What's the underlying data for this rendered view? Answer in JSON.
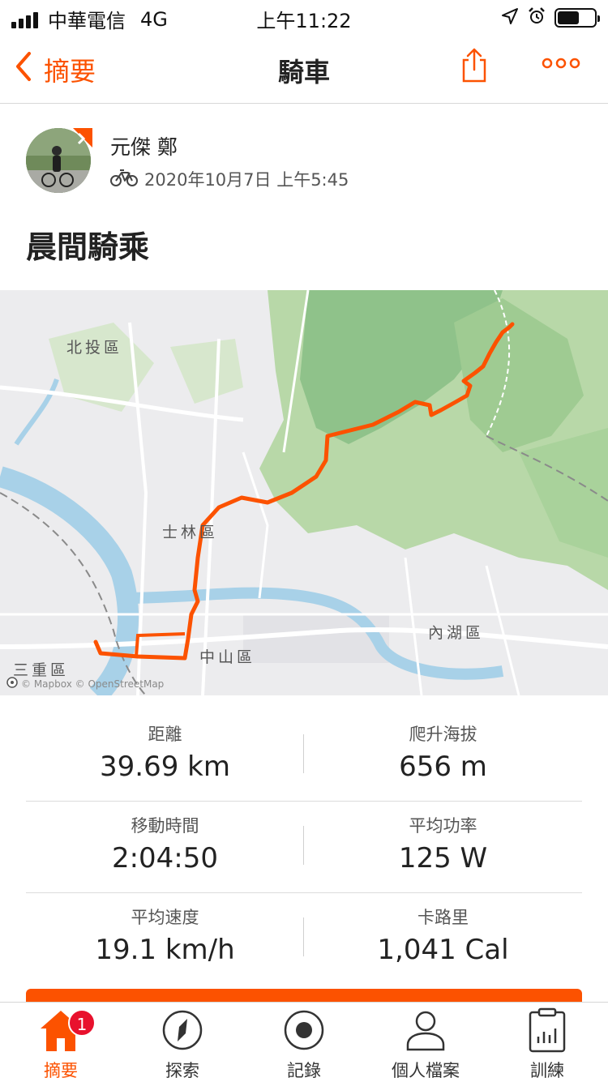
{
  "status_bar": {
    "carrier": "中華電信",
    "network": "4G",
    "time": "上午11:22",
    "battery_level": 0.6
  },
  "nav": {
    "back_label": "摘要",
    "title": "騎車",
    "icons": [
      "chevron-left-icon",
      "share-icon",
      "more-icon"
    ]
  },
  "athlete": {
    "name": "元傑 鄭",
    "datetime": "2020年10月7日 上午5:45",
    "sport_icon": "bike-icon"
  },
  "activity": {
    "title": "晨間騎乘"
  },
  "map": {
    "labels": {
      "beitou": "北投區",
      "shilin": "士林區",
      "neihu": "內湖區",
      "zhongshan": "中山區",
      "sanchong": "三重區"
    },
    "attribution": "© Mapbox © OpenStreetMap",
    "route_color": "#fc5200"
  },
  "stats": [
    {
      "label": "距離",
      "value": "39.69 km"
    },
    {
      "label": "爬升海拔",
      "value": "656 m"
    },
    {
      "label": "移動時間",
      "value": "2:04:50"
    },
    {
      "label": "平均功率",
      "value": "125 W"
    },
    {
      "label": "平均速度",
      "value": "19.1 km/h"
    },
    {
      "label": "卡路里",
      "value": "1,041 Cal"
    }
  ],
  "tabbar": {
    "tabs": [
      {
        "label": "摘要",
        "icon": "home-icon",
        "badge": "1",
        "active": true
      },
      {
        "label": "探索",
        "icon": "compass-icon"
      },
      {
        "label": "記錄",
        "icon": "record-icon"
      },
      {
        "label": "個人檔案",
        "icon": "profile-icon"
      },
      {
        "label": "訓練",
        "icon": "training-icon"
      }
    ]
  },
  "colors": {
    "accent": "#fc5200",
    "badge": "#e8112d"
  }
}
